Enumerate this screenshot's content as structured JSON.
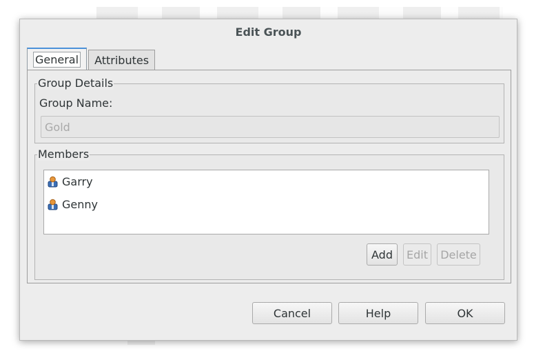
{
  "dialog": {
    "title": "Edit Group"
  },
  "tabs": [
    {
      "label": "General",
      "active": true
    },
    {
      "label": "Attributes",
      "active": false
    }
  ],
  "group_details": {
    "legend": "Group Details",
    "name_label": "Group Name:",
    "name_value": "Gold",
    "name_enabled": false
  },
  "members": {
    "legend": "Members",
    "items": [
      {
        "name": "Garry",
        "icon": "user-icon"
      },
      {
        "name": "Genny",
        "icon": "user-icon"
      }
    ],
    "add_label": "Add",
    "edit_label": "Edit",
    "delete_label": "Delete",
    "edit_enabled": false,
    "delete_enabled": false
  },
  "footer": {
    "cancel_label": "Cancel",
    "help_label": "Help",
    "ok_label": "OK"
  },
  "colors": {
    "dialog_bg": "#ededed",
    "active_tab_accent": "#4a90d9",
    "disabled_text": "#a5a5a5",
    "user_icon_body": "#3b6fb6",
    "user_icon_head": "#e8973a"
  }
}
